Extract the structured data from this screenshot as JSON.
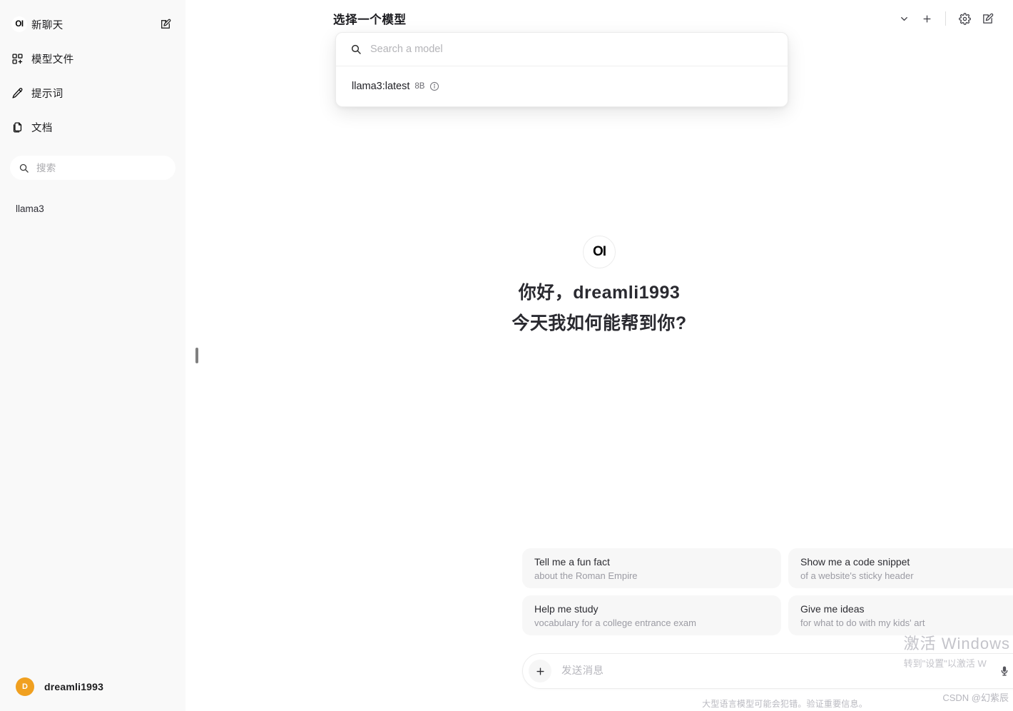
{
  "sidebar": {
    "logo_text": "OI",
    "new_chat_label": "新聊天",
    "new_chat_icon": "compose-icon",
    "items": [
      {
        "label": "模型文件",
        "icon": "grid-plus-icon"
      },
      {
        "label": "提示词",
        "icon": "pencil-icon"
      },
      {
        "label": "文档",
        "icon": "documents-icon"
      }
    ],
    "search": {
      "placeholder": "搜索",
      "value": "",
      "icon": "search-icon"
    },
    "chats": [
      {
        "title": "llama3"
      }
    ],
    "user": {
      "initial": "D",
      "name": "dreamli1993",
      "avatar_color": "#f0a020"
    }
  },
  "topbar": {
    "model_title": "选择一个模型",
    "actions": [
      {
        "name": "chevron-down-icon"
      },
      {
        "name": "plus-icon"
      },
      {
        "name": "gear-icon"
      },
      {
        "name": "compose-icon"
      }
    ]
  },
  "model_dropdown": {
    "search": {
      "placeholder": "Search a model",
      "value": "",
      "icon": "search-icon"
    },
    "models": [
      {
        "name": "llama3:latest",
        "size": "8B",
        "info_icon": "info-icon"
      }
    ]
  },
  "hero": {
    "logo_text": "OI",
    "greeting_line1": "你好，dreamli1993",
    "greeting_line2": "今天我如何能帮到你?"
  },
  "suggestions": [
    {
      "title": "Tell me a fun fact",
      "subtitle": "about the Roman Empire"
    },
    {
      "title": "Show me a code snippet",
      "subtitle": "of a website's sticky header"
    },
    {
      "title": "Help me study",
      "subtitle": "vocabulary for a college entrance exam"
    },
    {
      "title": "Give me ideas",
      "subtitle": "for what to do with my kids' art"
    }
  ],
  "composer": {
    "placeholder": "发送消息",
    "value": "",
    "plus_icon": "plus-icon",
    "mic_icon": "microphone-icon",
    "send_icon": "arrow-up-icon",
    "disclaimer": "大型语言模型可能会犯错。验证重要信息。"
  },
  "watermark": {
    "line1": "激活 Windows",
    "line2": "转到\"设置\"以激活 W",
    "credit": "CSDN @幻紫辰"
  }
}
